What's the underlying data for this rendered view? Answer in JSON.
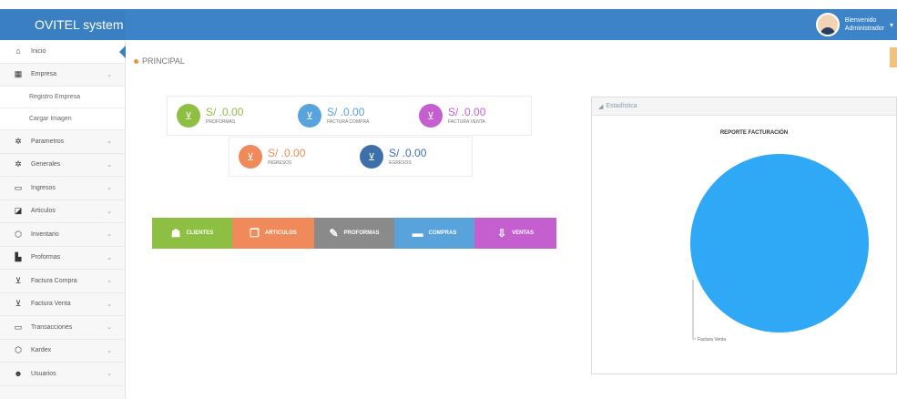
{
  "app": {
    "title": "OVITEL system"
  },
  "user": {
    "greeting": "Bienvenido",
    "role": "Administrador"
  },
  "sidebar": {
    "items": [
      {
        "label": "Inicio",
        "icon": "home-icon",
        "glyph": "⌂",
        "chevron": false
      },
      {
        "label": "Empresa",
        "icon": "building-icon",
        "glyph": "▦",
        "chevron": true
      },
      {
        "label": "Parametros",
        "icon": "gear-icon",
        "glyph": "✲",
        "chevron": true
      },
      {
        "label": "Generales",
        "icon": "cogs-icon",
        "glyph": "✲",
        "chevron": true
      },
      {
        "label": "Ingresos",
        "icon": "monitor-icon",
        "glyph": "▭",
        "chevron": true
      },
      {
        "label": "Articulos",
        "icon": "cube-icon",
        "glyph": "◪",
        "chevron": true
      },
      {
        "label": "Inventario",
        "icon": "cube-outline-icon",
        "glyph": "⬡",
        "chevron": true
      },
      {
        "label": "Proformas",
        "icon": "document-icon",
        "glyph": "▙",
        "chevron": true
      },
      {
        "label": "Factura Compra",
        "icon": "cart-icon",
        "glyph": "⊻",
        "chevron": true
      },
      {
        "label": "Factura Venta",
        "icon": "cart-icon",
        "glyph": "⊻",
        "chevron": true
      },
      {
        "label": "Transacciones",
        "icon": "folder-icon",
        "glyph": "▭",
        "chevron": true
      },
      {
        "label": "Kardex",
        "icon": "cube-outline-icon",
        "glyph": "⬡",
        "chevron": true
      },
      {
        "label": "Usuarios",
        "icon": "users-icon",
        "glyph": "☻",
        "chevron": true
      }
    ],
    "submenu": [
      "Registro Empresa",
      "Cargar Imagen"
    ]
  },
  "breadcrumb": "PRINCIPAL",
  "stats": [
    {
      "value": "S/ .0.00",
      "label": "PROFORMAS",
      "color": "#8dbf42"
    },
    {
      "value": "S/ .0.00",
      "label": "FACTURA COMPRA",
      "color": "#59a3dd"
    },
    {
      "value": "S/ .0.00",
      "label": "FACTURA VENTA",
      "color": "#c55fd0"
    },
    {
      "value": "S/ .0.00",
      "label": "INGRESOS",
      "color": "#f08a5a"
    },
    {
      "value": "S/ .0.00",
      "label": "EGRESOS",
      "color": "#3d6fa8"
    }
  ],
  "modules": [
    {
      "label": "CLIENTES",
      "icon": "user-icon",
      "glyph": "☗",
      "color": "#8dbf42"
    },
    {
      "label": "ARTICULOS",
      "icon": "box-icon",
      "glyph": "❒",
      "color": "#f08a5a"
    },
    {
      "label": "PROFORMAS",
      "icon": "edit-icon",
      "glyph": "✎",
      "color": "#8a8a8a"
    },
    {
      "label": "COMPRAS",
      "icon": "credit-card-icon",
      "glyph": "▬",
      "color": "#59a3dd"
    },
    {
      "label": "VENTAS",
      "icon": "download-icon",
      "glyph": "⇩",
      "color": "#c55fd0"
    }
  ],
  "panel": {
    "title": "Estadística"
  },
  "chart_data": {
    "type": "pie",
    "title": "REPORTE FACTURACIÓN",
    "slices": [
      {
        "label": "Factura Venta",
        "value": 100,
        "color": "#2fa9f5"
      }
    ]
  }
}
